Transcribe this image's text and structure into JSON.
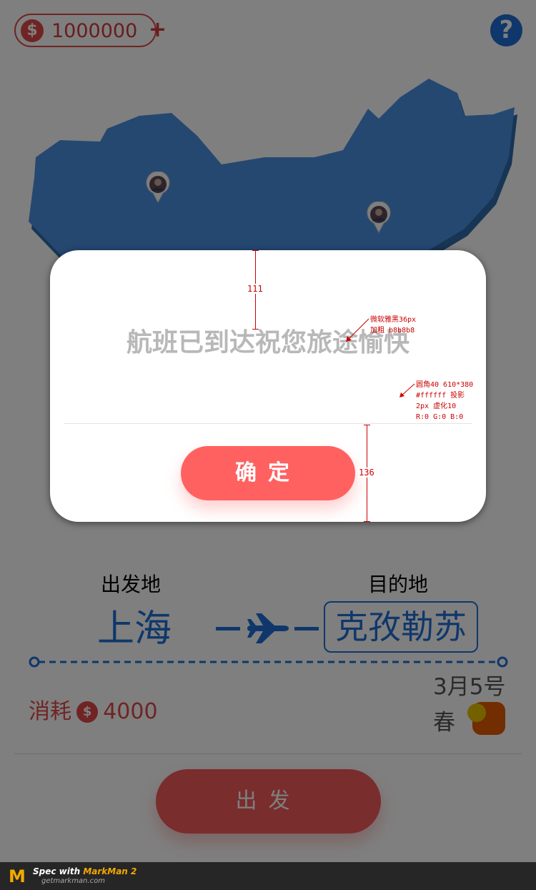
{
  "header": {
    "coin_symbol": "$",
    "coins": "1000000",
    "plus": "+",
    "help_symbol": "?"
  },
  "map": {
    "icon": "china-map-icon",
    "pins": [
      "avatar-pin-icon",
      "avatar-pin-icon"
    ]
  },
  "panel": {
    "origin_label": "出发地",
    "dest_label": "目的地",
    "origin_city": "上海",
    "dest_city": "克孜勒苏",
    "plane_icon": "airplane-icon",
    "date": "3月5号",
    "season": "春",
    "season_icon": "season-badge-icon",
    "cost_label": "消耗",
    "cost_coin": "$",
    "cost_value": "4000",
    "depart_button": "出发"
  },
  "modal": {
    "message": "航班已到达祝您旅途愉快",
    "confirm_button": "确定"
  },
  "annotations": {
    "top_spacing": "111",
    "bottom_spacing": "136",
    "text_note": "微软雅黑36px\n加粗 b8b8b8",
    "box_note": "圆角40 610*380\n#ffffff 投影\n2px 虚化10\nR:0 G:0 B:0"
  },
  "footer": {
    "logo": "M",
    "spec_prefix": "Spec with ",
    "brand": "MarkMan 2",
    "site": "getmarkman.com"
  },
  "colors": {
    "accent_red": "#ff6161",
    "brand_blue": "#1f6fd6",
    "map_blue": "#4a90e2",
    "message_gray": "#b8b8b8",
    "annotation_red": "#cc0000"
  }
}
